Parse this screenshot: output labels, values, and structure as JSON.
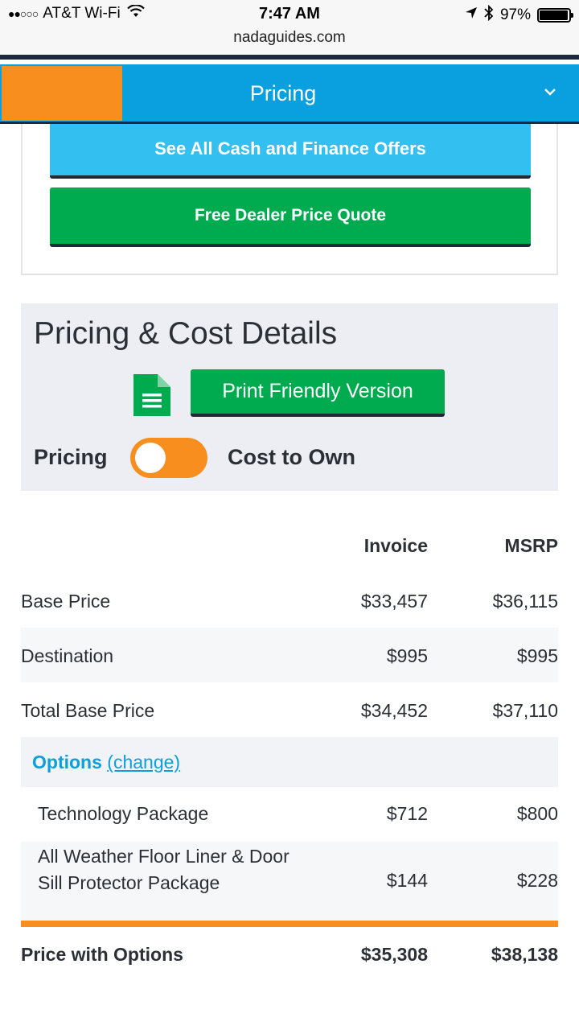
{
  "status_bar": {
    "carrier": "AT&T Wi-Fi",
    "time": "7:47 AM",
    "battery": "97%",
    "battery_level": 0.97
  },
  "browser": {
    "url": "nadaguides.com"
  },
  "nav": {
    "title": "Pricing"
  },
  "offers": {
    "cash_button": "See All Cash and Finance Offers",
    "quote_button": "Free Dealer Price Quote"
  },
  "details": {
    "title": "Pricing & Cost Details",
    "print_button": "Print Friendly Version",
    "toggle_left": "Pricing",
    "toggle_right": "Cost to Own"
  },
  "table": {
    "col_invoice": "Invoice",
    "col_msrp": "MSRP",
    "rows": [
      {
        "name": "Base Price",
        "invoice": "$33,457",
        "msrp": "$36,115"
      },
      {
        "name": "Destination",
        "invoice": "$995",
        "msrp": "$995"
      },
      {
        "name": "Total Base Price",
        "invoice": "$34,452",
        "msrp": "$37,110"
      }
    ],
    "options_label": "Options",
    "options_change": "(change)",
    "packages": [
      {
        "name": "Technology Package",
        "invoice": "$712",
        "msrp": "$800"
      },
      {
        "name": "All Weather Floor Liner & Door Sill Protector Package",
        "invoice": "$144",
        "msrp": "$228"
      }
    ],
    "total": {
      "name": "Price with Options",
      "invoice": "$35,308",
      "msrp": "$38,138"
    }
  },
  "colors": {
    "nav_blue": "#0aa0e0",
    "accent_orange": "#f78e1e",
    "green": "#00aa4f",
    "light_blue": "#33bff0",
    "dark_navy": "#1e2a3a"
  }
}
